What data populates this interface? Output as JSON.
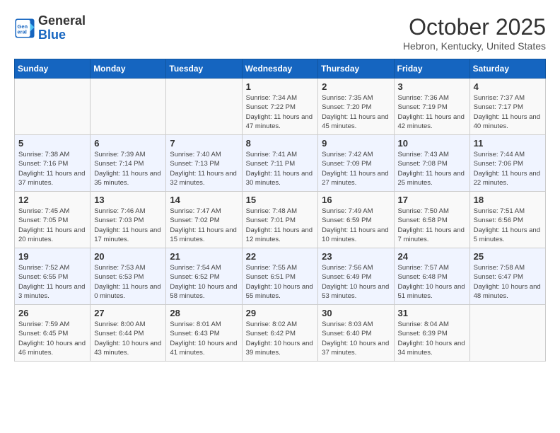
{
  "header": {
    "logo_line1": "General",
    "logo_line2": "Blue",
    "month": "October 2025",
    "location": "Hebron, Kentucky, United States"
  },
  "days_of_week": [
    "Sunday",
    "Monday",
    "Tuesday",
    "Wednesday",
    "Thursday",
    "Friday",
    "Saturday"
  ],
  "weeks": [
    [
      {
        "day": "",
        "info": ""
      },
      {
        "day": "",
        "info": ""
      },
      {
        "day": "",
        "info": ""
      },
      {
        "day": "1",
        "info": "Sunrise: 7:34 AM\nSunset: 7:22 PM\nDaylight: 11 hours\nand 47 minutes."
      },
      {
        "day": "2",
        "info": "Sunrise: 7:35 AM\nSunset: 7:20 PM\nDaylight: 11 hours\nand 45 minutes."
      },
      {
        "day": "3",
        "info": "Sunrise: 7:36 AM\nSunset: 7:19 PM\nDaylight: 11 hours\nand 42 minutes."
      },
      {
        "day": "4",
        "info": "Sunrise: 7:37 AM\nSunset: 7:17 PM\nDaylight: 11 hours\nand 40 minutes."
      }
    ],
    [
      {
        "day": "5",
        "info": "Sunrise: 7:38 AM\nSunset: 7:16 PM\nDaylight: 11 hours\nand 37 minutes."
      },
      {
        "day": "6",
        "info": "Sunrise: 7:39 AM\nSunset: 7:14 PM\nDaylight: 11 hours\nand 35 minutes."
      },
      {
        "day": "7",
        "info": "Sunrise: 7:40 AM\nSunset: 7:13 PM\nDaylight: 11 hours\nand 32 minutes."
      },
      {
        "day": "8",
        "info": "Sunrise: 7:41 AM\nSunset: 7:11 PM\nDaylight: 11 hours\nand 30 minutes."
      },
      {
        "day": "9",
        "info": "Sunrise: 7:42 AM\nSunset: 7:09 PM\nDaylight: 11 hours\nand 27 minutes."
      },
      {
        "day": "10",
        "info": "Sunrise: 7:43 AM\nSunset: 7:08 PM\nDaylight: 11 hours\nand 25 minutes."
      },
      {
        "day": "11",
        "info": "Sunrise: 7:44 AM\nSunset: 7:06 PM\nDaylight: 11 hours\nand 22 minutes."
      }
    ],
    [
      {
        "day": "12",
        "info": "Sunrise: 7:45 AM\nSunset: 7:05 PM\nDaylight: 11 hours\nand 20 minutes."
      },
      {
        "day": "13",
        "info": "Sunrise: 7:46 AM\nSunset: 7:03 PM\nDaylight: 11 hours\nand 17 minutes."
      },
      {
        "day": "14",
        "info": "Sunrise: 7:47 AM\nSunset: 7:02 PM\nDaylight: 11 hours\nand 15 minutes."
      },
      {
        "day": "15",
        "info": "Sunrise: 7:48 AM\nSunset: 7:01 PM\nDaylight: 11 hours\nand 12 minutes."
      },
      {
        "day": "16",
        "info": "Sunrise: 7:49 AM\nSunset: 6:59 PM\nDaylight: 11 hours\nand 10 minutes."
      },
      {
        "day": "17",
        "info": "Sunrise: 7:50 AM\nSunset: 6:58 PM\nDaylight: 11 hours\nand 7 minutes."
      },
      {
        "day": "18",
        "info": "Sunrise: 7:51 AM\nSunset: 6:56 PM\nDaylight: 11 hours\nand 5 minutes."
      }
    ],
    [
      {
        "day": "19",
        "info": "Sunrise: 7:52 AM\nSunset: 6:55 PM\nDaylight: 11 hours\nand 3 minutes."
      },
      {
        "day": "20",
        "info": "Sunrise: 7:53 AM\nSunset: 6:53 PM\nDaylight: 11 hours\nand 0 minutes."
      },
      {
        "day": "21",
        "info": "Sunrise: 7:54 AM\nSunset: 6:52 PM\nDaylight: 10 hours\nand 58 minutes."
      },
      {
        "day": "22",
        "info": "Sunrise: 7:55 AM\nSunset: 6:51 PM\nDaylight: 10 hours\nand 55 minutes."
      },
      {
        "day": "23",
        "info": "Sunrise: 7:56 AM\nSunset: 6:49 PM\nDaylight: 10 hours\nand 53 minutes."
      },
      {
        "day": "24",
        "info": "Sunrise: 7:57 AM\nSunset: 6:48 PM\nDaylight: 10 hours\nand 51 minutes."
      },
      {
        "day": "25",
        "info": "Sunrise: 7:58 AM\nSunset: 6:47 PM\nDaylight: 10 hours\nand 48 minutes."
      }
    ],
    [
      {
        "day": "26",
        "info": "Sunrise: 7:59 AM\nSunset: 6:45 PM\nDaylight: 10 hours\nand 46 minutes."
      },
      {
        "day": "27",
        "info": "Sunrise: 8:00 AM\nSunset: 6:44 PM\nDaylight: 10 hours\nand 43 minutes."
      },
      {
        "day": "28",
        "info": "Sunrise: 8:01 AM\nSunset: 6:43 PM\nDaylight: 10 hours\nand 41 minutes."
      },
      {
        "day": "29",
        "info": "Sunrise: 8:02 AM\nSunset: 6:42 PM\nDaylight: 10 hours\nand 39 minutes."
      },
      {
        "day": "30",
        "info": "Sunrise: 8:03 AM\nSunset: 6:40 PM\nDaylight: 10 hours\nand 37 minutes."
      },
      {
        "day": "31",
        "info": "Sunrise: 8:04 AM\nSunset: 6:39 PM\nDaylight: 10 hours\nand 34 minutes."
      },
      {
        "day": "",
        "info": ""
      }
    ]
  ]
}
